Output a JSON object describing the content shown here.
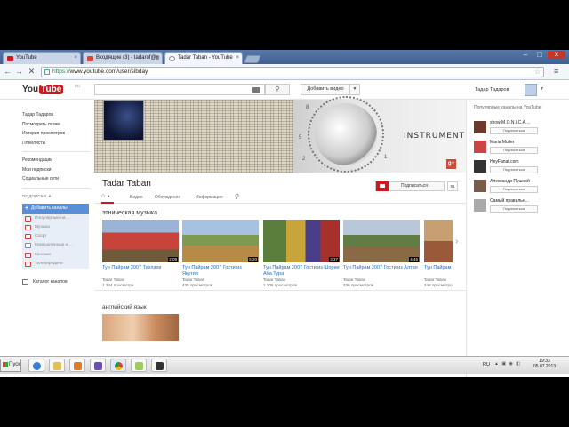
{
  "browser": {
    "tabs": [
      {
        "label": "YouTube",
        "fav_color": "#cc181e"
      },
      {
        "label": "Входящие (3) - tadarof@g",
        "fav_color": "#d44638"
      },
      {
        "label": "Tadar Taban - YouTube",
        "fav_color": "#cc181e"
      }
    ],
    "url_scheme": "https://",
    "url_rest": "www.youtube.com/user/sibday"
  },
  "masthead": {
    "logo_you": "You",
    "logo_tube": "Tube",
    "logo_region": "RU",
    "upload_label": "Добавить видео",
    "user_name": "Тадар Тадаров"
  },
  "guide": {
    "items": [
      "Тадар Тадаров",
      "Посмотреть позже",
      "История просмотров",
      "Плейлисты"
    ],
    "items2": [
      "Рекомендации",
      "Мои подписки",
      "Социальные сети"
    ],
    "subs_header": "ПОДПИСКИ",
    "add_channels": "Добавить каналы",
    "categories": [
      "Популярные на ...",
      "Музыка",
      "Спорт",
      "Компьютерные и ...",
      "Кинозал",
      "Телепередачи"
    ],
    "catalog": "Каталог каналов"
  },
  "channel": {
    "banner_text": "INSTRUMENT",
    "title": "Tadar Taban",
    "subscribe_label": "Подписаться",
    "subscribe_count": "91",
    "tabs": [
      "Видео",
      "Обсуждение",
      "Информация"
    ],
    "section1_title": "этническая музыка",
    "videos": [
      {
        "title": "Тун Пайрам 2007 Тахпахи",
        "author": "Tadar Taban",
        "views": "1 344 просмотра",
        "duration": "2:09"
      },
      {
        "title": "Тун Пайрам 2007 Гости из Якутии",
        "author": "Tadar Taban",
        "views": "435 просмотров",
        "duration": "5:20"
      },
      {
        "title": "Тун Пайрам 2007 Гости из Шории Аба Тура",
        "author": "Tadar Taban",
        "views": "1 305 просмотров",
        "duration": "3:37"
      },
      {
        "title": "Тун Пайрам 2007 Гости из Алтая",
        "author": "Tadar Taban",
        "views": "336 просмотров",
        "duration": "4:45"
      },
      {
        "title": "Тун Пайрам",
        "author": "Tadar Taban",
        "views": "248 просмотро",
        "duration": ""
      }
    ],
    "section2_title": "английский язык"
  },
  "right": {
    "title": "Популярные каналы на YouTube",
    "channels": [
      {
        "name": "show M.O.N.I.C.A....",
        "sub": "Подписаться",
        "color": "#6b3a2a"
      },
      {
        "name": "Maria Muller",
        "sub": "Подписаться",
        "color": "#c44"
      },
      {
        "name": "HeyFanat.com",
        "sub": "Подписаться",
        "color": "#333"
      },
      {
        "name": "Александр Пушной",
        "sub": "Подписаться",
        "color": "#7a5a4a"
      },
      {
        "name": "Самый правильн...",
        "sub": "Подписаться",
        "color": "#aaa"
      }
    ]
  },
  "taskbar": {
    "start_label": "Пуск",
    "lang": "RU",
    "time": "19:33",
    "date": "05.07.2013"
  }
}
